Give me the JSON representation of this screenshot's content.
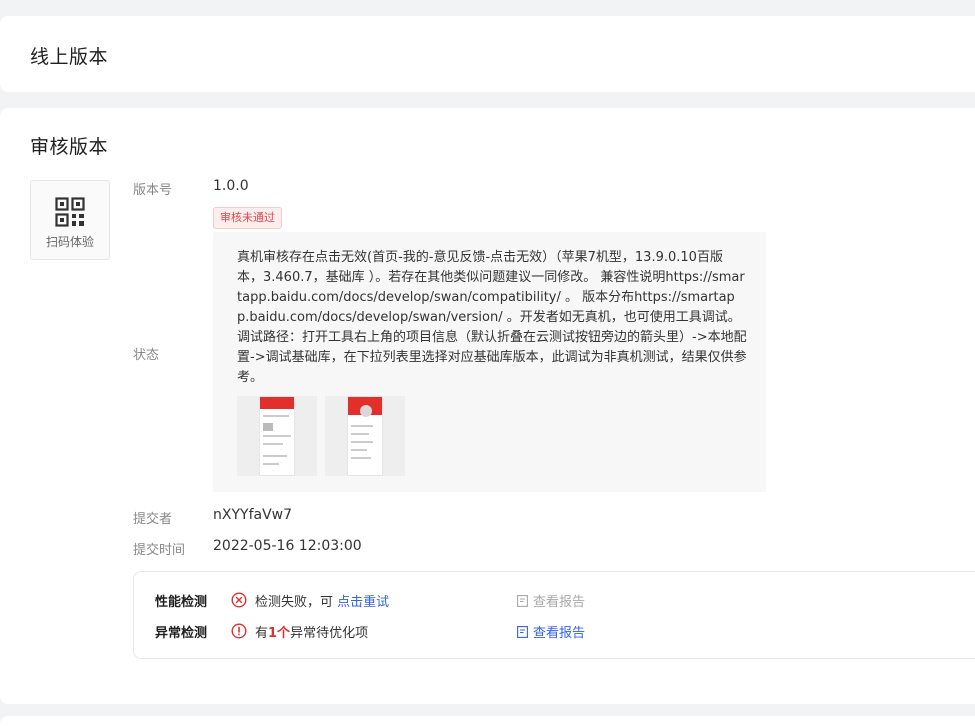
{
  "online_section": {
    "title": "线上版本"
  },
  "review_section": {
    "title": "审核版本",
    "qr": {
      "label": "扫码体验",
      "icon": "qr-code-icon"
    },
    "version": {
      "label": "版本号",
      "value": "1.0.0"
    },
    "status": {
      "label": "状态",
      "badge": "审核未通过",
      "reason": "真机审核存在点击无效(首页-我的-意见反馈-点击无效）（苹果7机型，13.9.0.10百版本，3.460.7，基础库 ）。若存在其他类似问题建议一同修改。 兼容性说明https://smartapp.baidu.com/docs/develop/swan/compatibility/ 。 版本分布https://smartapp.baidu.com/docs/develop/swan/version/ 。开发者如无真机，也可使用工具调试。 调试路径：打开工具右上角的项目信息（默认折叠在云测试按钮旁边的箭头里）->本地配置->调试基础库，在下拉列表里选择对应基础库版本，此调试为非真机测试，结果仅供参考。"
    },
    "submitter": {
      "label": "提交者",
      "value": "nXYYfaVw7"
    },
    "submit_time": {
      "label": "提交时间",
      "value": "2022-05-16 12:03:00"
    },
    "checks": {
      "performance": {
        "name": "性能检测",
        "text_prefix": "检测失败，可 ",
        "link": "点击重试",
        "report": "查看报告",
        "status_color": "#e0302d"
      },
      "exception": {
        "name": "异常检测",
        "text_prefix": "有",
        "count": "1个",
        "text_suffix": "异常待优化项",
        "report": "查看报告",
        "status_color": "#e0302d"
      }
    }
  },
  "colors": {
    "accent": "#3562e3",
    "error": "#e0302d",
    "background": "#f2f3f5"
  }
}
